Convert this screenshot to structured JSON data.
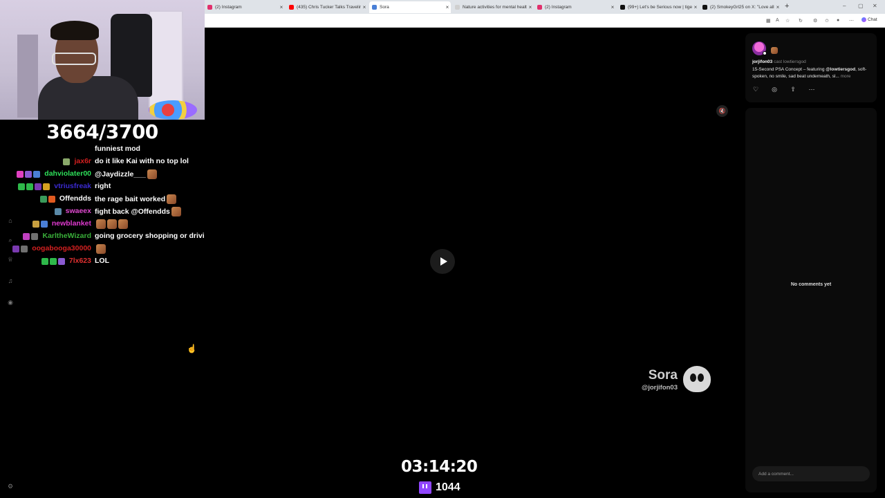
{
  "browser": {
    "tabs": [
      {
        "label": "(2) Instagram",
        "favicon_color": "#e1306c",
        "active": false
      },
      {
        "label": "(435) Chris Tucker Talks Traveling",
        "favicon_color": "#ff0000",
        "active": false
      },
      {
        "label": "Sora",
        "favicon_color": "#4a7fd6",
        "active": true
      },
      {
        "label": "Nature activities for mental health",
        "favicon_color": "#cfcfcf",
        "active": false
      },
      {
        "label": "(2) Instagram",
        "favicon_color": "#e1306c",
        "active": false
      },
      {
        "label": "(99+) Let's be Serious now | tiger",
        "favicon_color": "#111111",
        "active": false
      },
      {
        "label": "(2) SmokeyGrl25 on X: \"Love all th",
        "favicon_color": "#111111",
        "active": false
      }
    ],
    "new_tab_symbol": "+",
    "chat_label": "Chat"
  },
  "stream": {
    "goal_count": "3664/3700",
    "timer": "03:14:20",
    "viewer_count": "1044",
    "chat": [
      {
        "user": "",
        "user_color": "#ffffff",
        "message": "funniest mod",
        "badges": [],
        "emotes": 0
      },
      {
        "user": "jax6r",
        "user_color": "#d21f1f",
        "message": "do it like Kai with no top lol",
        "badges": [
          "#8aa86a"
        ],
        "emotes": 0
      },
      {
        "user": "dahviolater00",
        "user_color": "#2ee05a",
        "message": "@Jaydizzle___",
        "badges": [
          "#e040c0",
          "#8a5ad0",
          "#4a7fd6"
        ],
        "emotes": 1
      },
      {
        "user": "vtriusfreak",
        "user_color": "#3a2ad0",
        "message": "right",
        "badges": [
          "#2eb84a",
          "#2eb84a",
          "#7a3ab0",
          "#d6a020"
        ],
        "emotes": 0
      },
      {
        "user": "Offendds",
        "user_color": "#ffffff",
        "message": "the rage bait worked",
        "badges": [
          "#3a9a5a",
          "#e05a20"
        ],
        "emotes": 1
      },
      {
        "user": "swaeex",
        "user_color": "#e04ad0",
        "message": "fight back @Offendds",
        "badges": [
          "#5a8aa8"
        ],
        "emotes": 1
      },
      {
        "user": "newblanket",
        "user_color": "#e03ad0",
        "message": "",
        "badges": [
          "#c8a040",
          "#4a7fd6"
        ],
        "emotes": 3
      },
      {
        "user": "KarltheWizard",
        "user_color": "#3ab03a",
        "message": "going grocery shopping or driving",
        "badges": [
          "#c040c0",
          "#707070"
        ],
        "emotes": 0
      },
      {
        "user": "oogabooga30000",
        "user_color": "#d42020",
        "message": "",
        "badges": [
          "#7a3ab0",
          "#707070"
        ],
        "emotes": 1
      },
      {
        "user": "7lx623",
        "user_color": "#e03030",
        "message": "LOL",
        "badges": [
          "#2eb84a",
          "#2eb84a",
          "#8a5ad0"
        ],
        "emotes": 0
      }
    ]
  },
  "video": {
    "watermark_brand": "Sora",
    "watermark_handle": "@jorjifon03"
  },
  "post": {
    "author": "jorjifon03",
    "cast_label": "cast lowtiersgod",
    "text_before": "15-Second PSA Concept – featuring ",
    "mention": "@lowtiersgod",
    "text_after": ", soft-spoken, no smile, sad beat underneath, sl...",
    "more_label": "more"
  },
  "comments": {
    "empty_label": "No comments yet",
    "input_placeholder": "Add a comment..."
  },
  "icons": {
    "like": "heart-icon",
    "remix": "remix-icon",
    "share": "share-icon",
    "more": "more-icon",
    "mute": "speaker-muted-icon",
    "play": "play-icon"
  }
}
